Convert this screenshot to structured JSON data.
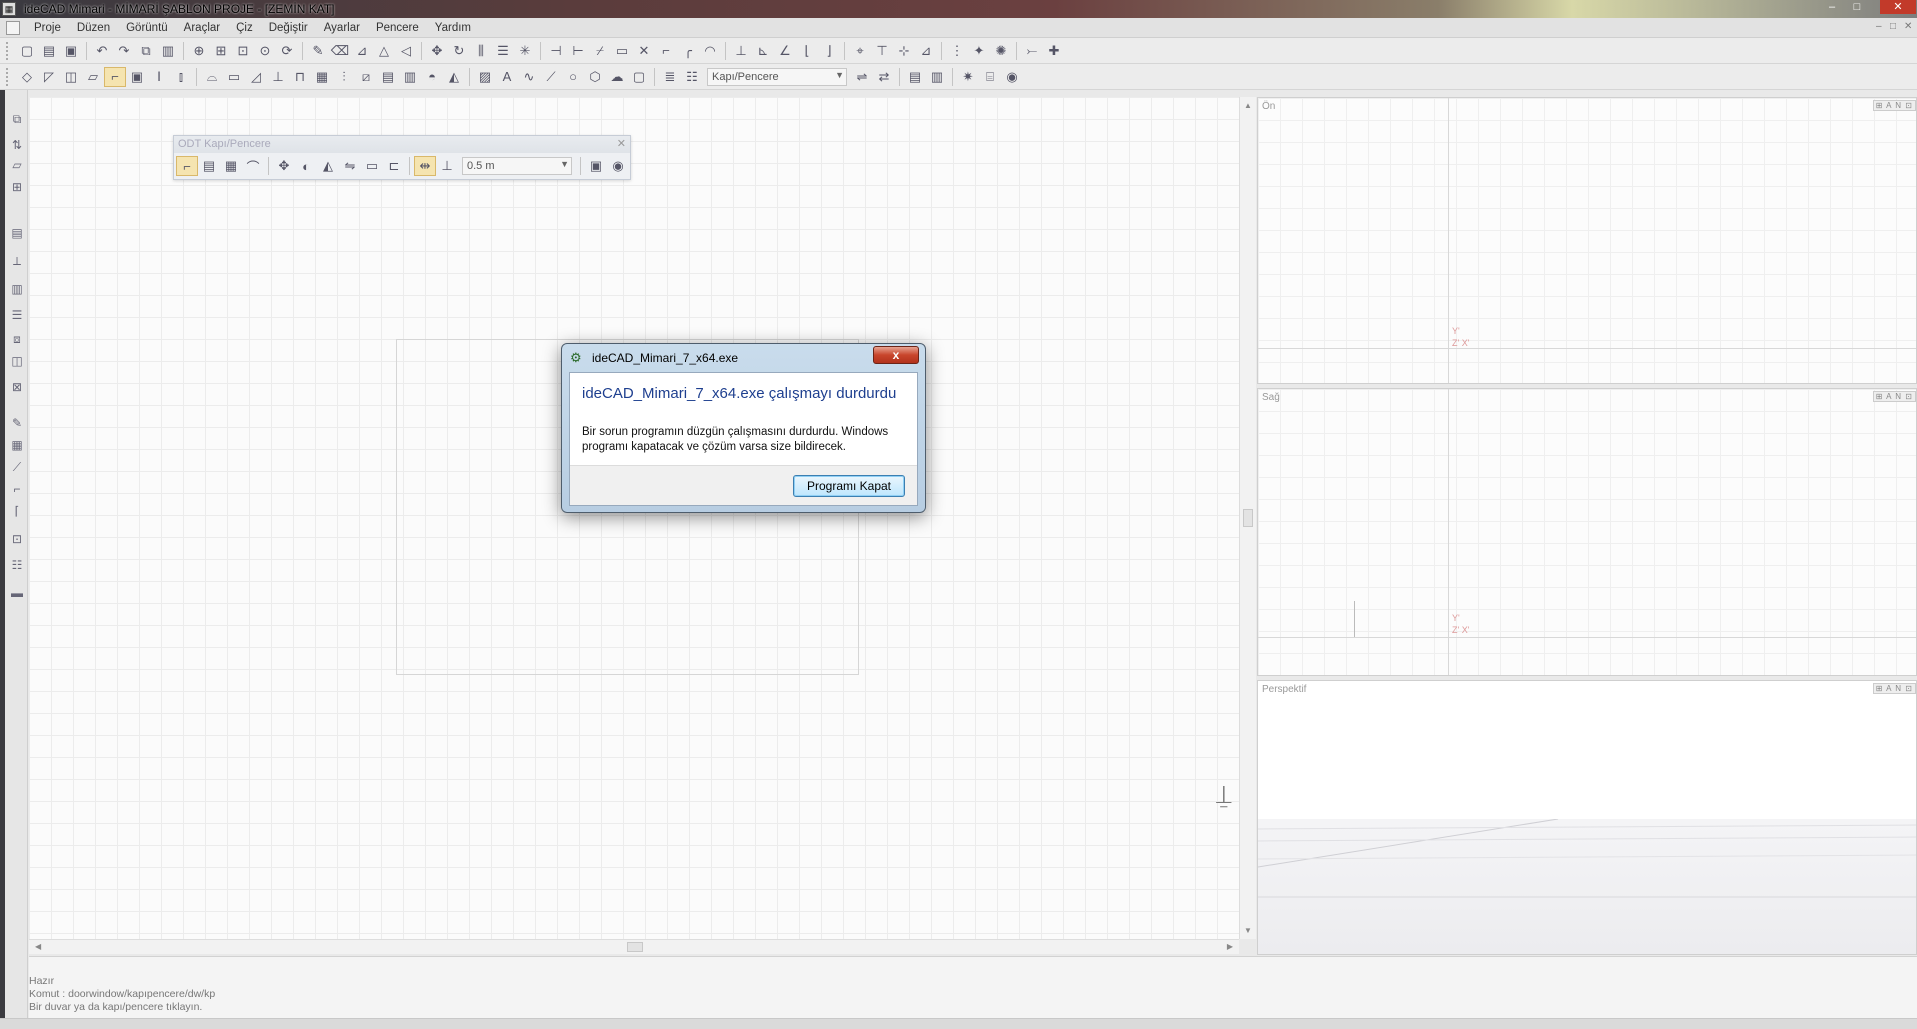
{
  "window": {
    "title": "ideCAD Mimari - MİMARİ ŞABLON PROJE - [ZEMİN KAT]",
    "controls": [
      "–",
      "□",
      "✕"
    ]
  },
  "menubar": {
    "items": [
      "Proje",
      "Düzen",
      "Görüntü",
      "Araçlar",
      "Çiz",
      "Değiştir",
      "Ayarlar",
      "Pencere",
      "Yardım"
    ],
    "mdi_controls": [
      "–",
      "□",
      "✕"
    ]
  },
  "toolbar2": {
    "combo_value": "Kapı/Pencere"
  },
  "odt_toolbar": {
    "title": "ODT Kapı/Pencere",
    "close": "✕",
    "combo_value": "0.5 m"
  },
  "viewports": {
    "front": {
      "label": "Ön",
      "controls": "⊞ A N ⊡"
    },
    "right": {
      "label": "Sağ",
      "controls": "⊞ A N ⊡"
    },
    "perspective": {
      "label": "Perspektif",
      "controls": "⊞ A N ⊡"
    },
    "axis_y": "Y'",
    "axis_zx": "Z' X'"
  },
  "command_area": {
    "lines": [
      "Hazır",
      "Komut : doorwindow/kapıpencere/dw/kp",
      "Bir duvar ya da kapı/pencere tıklayın."
    ]
  },
  "dialog": {
    "title": "ideCAD_Mimari_7_x64.exe",
    "close_label": "x",
    "heading": "ideCAD_Mimari_7_x64.exe çalışmayı durdurdu",
    "message": "Bir sorun programın düzgün çalışmasını durdurdu. Windows programı kapatacak ve çözüm varsa size bildirecek.",
    "button": "Programı Kapat"
  },
  "colors": {
    "dialog_heading": "#1e3f8f",
    "close_button": "#c8452c",
    "axis": "#d99999"
  },
  "icons": {
    "toolbar1": [
      "new-file-icon",
      "open-folder-icon",
      "save-icon",
      "undo-icon",
      "redo-icon",
      "zoom-in-icon",
      "zoom-window-icon",
      "zoom-extents-icon",
      "pan-icon",
      "pencil-icon",
      "move-icon",
      "rotate-icon",
      "mirror-icon",
      "trim-icon",
      "extend-icon",
      "offset-icon",
      "fillet-icon",
      "dimension-icon",
      "snap-icon"
    ],
    "toolbar2": [
      "column-icon",
      "beam-icon",
      "wall-icon",
      "door-window-icon",
      "slab-icon",
      "stair-icon",
      "roof-icon",
      "grid-icon",
      "text-icon",
      "line-icon",
      "arc-icon",
      "circle-icon",
      "layer-icon"
    ],
    "odt": [
      "door-type-icon",
      "window-type-icon",
      "grid-type-icon",
      "arc-door-icon",
      "align-icon",
      "flip-icon",
      "mirror-icon",
      "swap-icon",
      "width-icon",
      "height-icon",
      "settings-icon",
      "render-icon"
    ]
  }
}
